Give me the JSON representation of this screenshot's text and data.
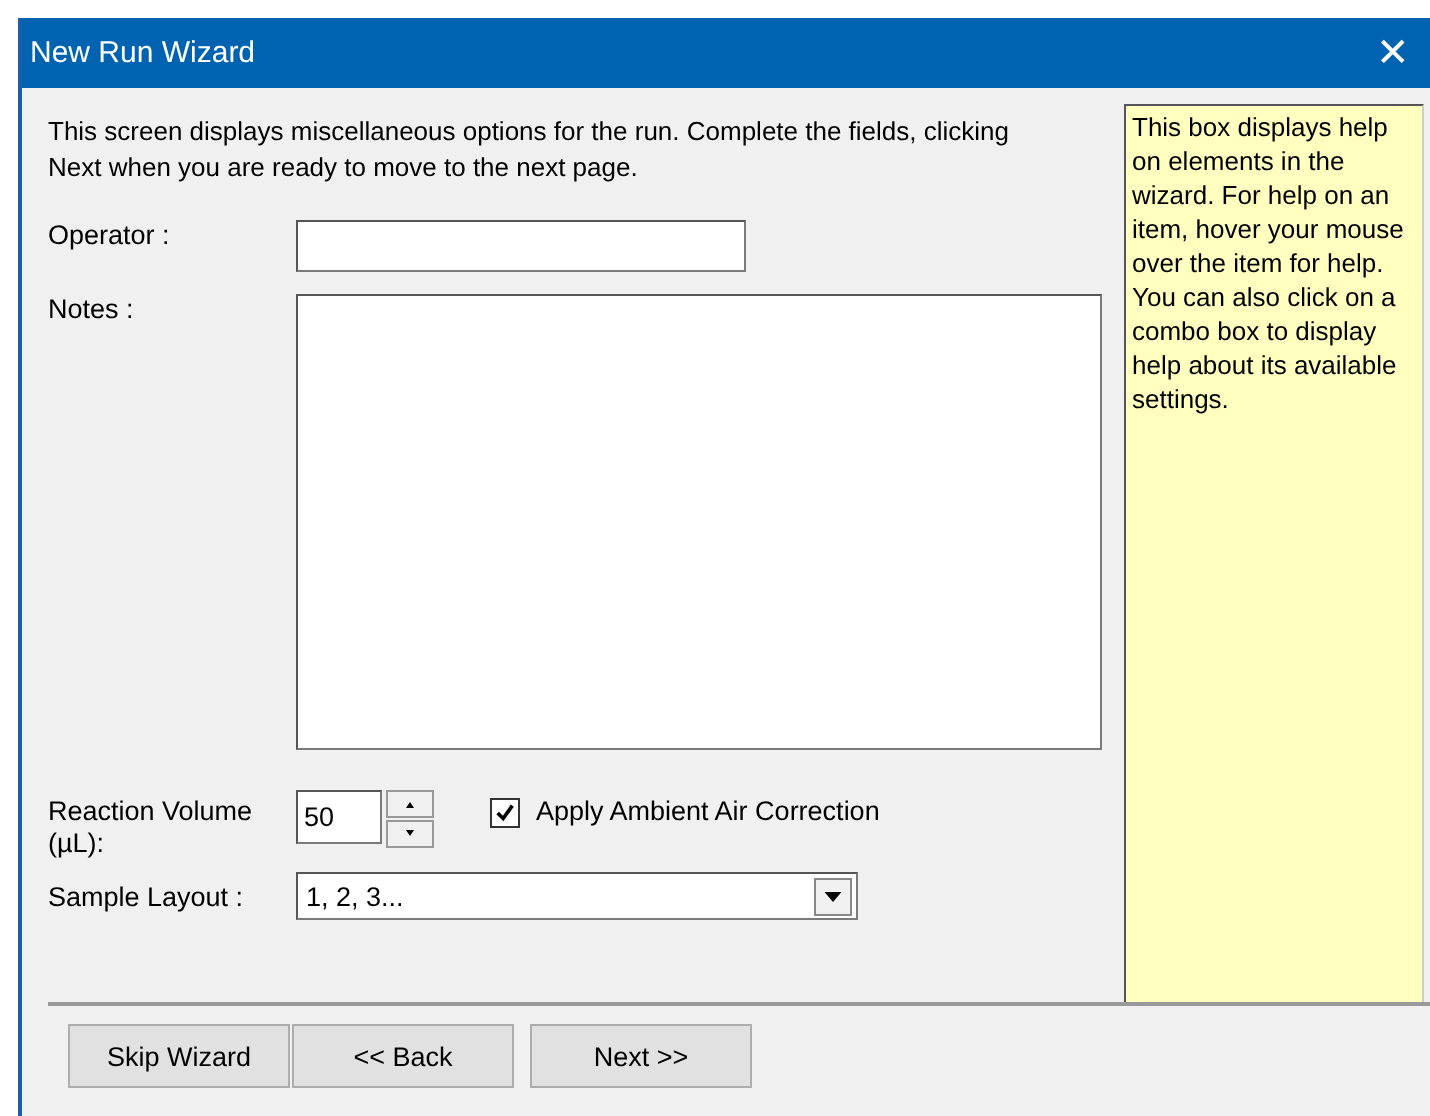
{
  "window": {
    "title": "New Run Wizard",
    "close": "✕"
  },
  "intro": "This screen displays miscellaneous options for the run. Complete the fields, clicking Next when you are ready to move to the next page.",
  "operator": {
    "label": "Operator :"
  },
  "notes": {
    "label": "Notes :"
  },
  "reaction_volume": {
    "label": "Reaction Volume (µL):",
    "value": "50"
  },
  "ambient_air": {
    "label": "Apply Ambient Air Correction",
    "checked": true
  },
  "sample_layout": {
    "label": "Sample Layout :",
    "value": "1, 2, 3..."
  },
  "help": "This box displays help on elements in the wizard. For help on an item, hover your mouse over the item for help. You can also click on a combo box to display help about its available settings.",
  "buttons": [
    "Skip Wizard",
    "<< Back",
    "Next >>"
  ]
}
